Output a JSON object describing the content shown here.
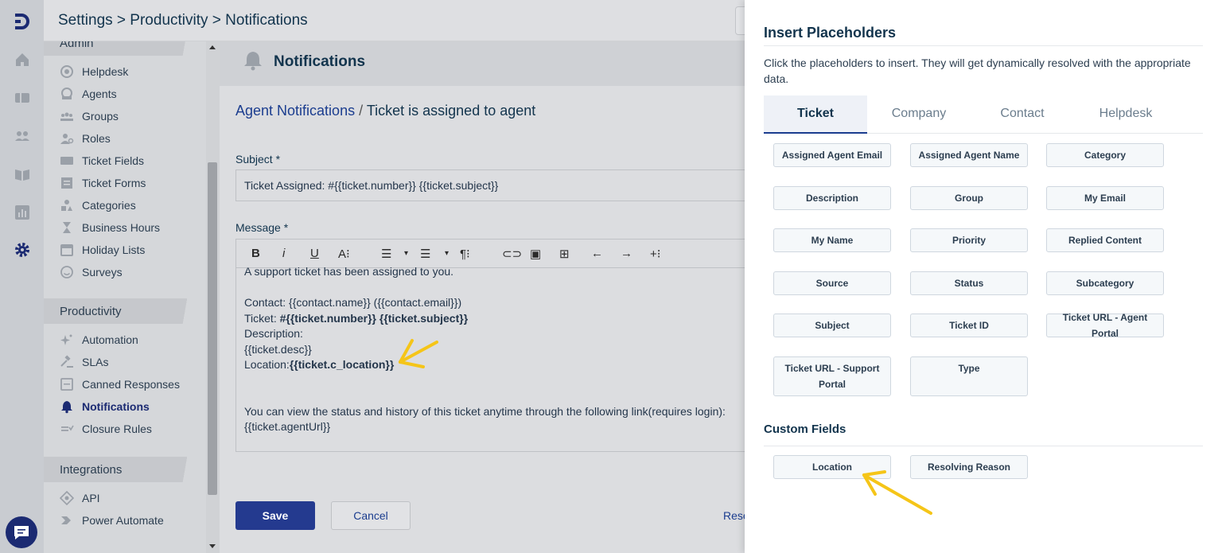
{
  "header": {
    "breadcrumb": "Settings > Productivity > Notifications"
  },
  "rail": {
    "icons": [
      "brand-logo",
      "home-icon",
      "tickets-icon",
      "contacts-icon",
      "knowledge-base-icon",
      "reports-icon",
      "settings-icon",
      "chat-icon"
    ],
    "accent": "#1b2a72"
  },
  "sidebar": {
    "partial_section": "Admin",
    "admin_items": [
      {
        "label": "Helpdesk",
        "icon": "helpdesk-icon"
      },
      {
        "label": "Agents",
        "icon": "agents-icon"
      },
      {
        "label": "Groups",
        "icon": "groups-icon"
      },
      {
        "label": "Roles",
        "icon": "roles-icon"
      },
      {
        "label": "Ticket Fields",
        "icon": "ticket-fields-icon"
      },
      {
        "label": "Ticket Forms",
        "icon": "ticket-forms-icon"
      },
      {
        "label": "Categories",
        "icon": "categories-icon"
      },
      {
        "label": "Business Hours",
        "icon": "hourglass-icon"
      },
      {
        "label": "Holiday Lists",
        "icon": "calendar-icon"
      },
      {
        "label": "Surveys",
        "icon": "smiley-icon"
      }
    ],
    "productivity_section": "Productivity",
    "productivity_items": [
      {
        "label": "Automation",
        "icon": "sparkle-icon"
      },
      {
        "label": "SLAs",
        "icon": "gavel-icon"
      },
      {
        "label": "Canned Responses",
        "icon": "canned-response-icon"
      },
      {
        "label": "Notifications",
        "icon": "bell-icon",
        "active": true
      },
      {
        "label": "Closure Rules",
        "icon": "closure-rules-icon"
      }
    ],
    "integrations_section": "Integrations",
    "integrations_items": [
      {
        "label": "API",
        "icon": "api-icon"
      },
      {
        "label": "Power Automate",
        "icon": "power-automate-icon"
      }
    ]
  },
  "main": {
    "title": "Notifications",
    "breadcrumb_link": "Agent Notifications",
    "breadcrumb_sep": "/",
    "breadcrumb_current": "Ticket is assigned to agent",
    "subject_label": "Subject *",
    "subject_value": "Ticket Assigned: #{{ticket.number}} {{ticket.subject}}",
    "message_label": "Message *",
    "toolbar": [
      "B",
      "i",
      "U",
      "A⁝",
      "☰",
      "▾",
      "☰",
      "▾",
      "¶⁝",
      "⊂⊃",
      "▣",
      "⊞",
      "←",
      "→",
      "+⁝"
    ],
    "body": {
      "line0": "A support ticket has been assigned to you.",
      "contact": "Contact: {{contact.name}} ({{contact.email}})",
      "ticket_prefix": "Ticket: ",
      "ticket_bold": "#{{ticket.number}} {{ticket.subject}}",
      "description": "Description:",
      "desc_ph": "{{ticket.desc}}",
      "location_prefix": "Location:",
      "location_bold": "{{ticket.c_location}}",
      "view_line": "You can view the status and history of this ticket anytime through the following link(requires login):",
      "url_ph": "{{ticket.agentUrl}}"
    },
    "save_label": "Save",
    "cancel_label": "Cancel",
    "reset_partial": "Rese"
  },
  "drawer": {
    "title": "Insert Placeholders",
    "description": "Click the placeholders to insert. They will get dynamically resolved with the appropriate data.",
    "tabs": [
      "Ticket",
      "Company",
      "Contact",
      "Helpdesk"
    ],
    "active_tab": "Ticket",
    "placeholders": [
      "Assigned Agent Email",
      "Assigned Agent Name",
      "Category",
      "Description",
      "Group",
      "My Email",
      "My Name",
      "Priority",
      "Replied Content",
      "Source",
      "Status",
      "Subcategory",
      "Subject",
      "Ticket ID",
      "Ticket URL - Agent Portal",
      "Ticket URL - Support Portal",
      "Type"
    ],
    "custom_fields_title": "Custom Fields",
    "custom_fields": [
      "Location",
      "Resolving Reason"
    ]
  },
  "annotations": {
    "arrow_color": "#f5c518"
  }
}
